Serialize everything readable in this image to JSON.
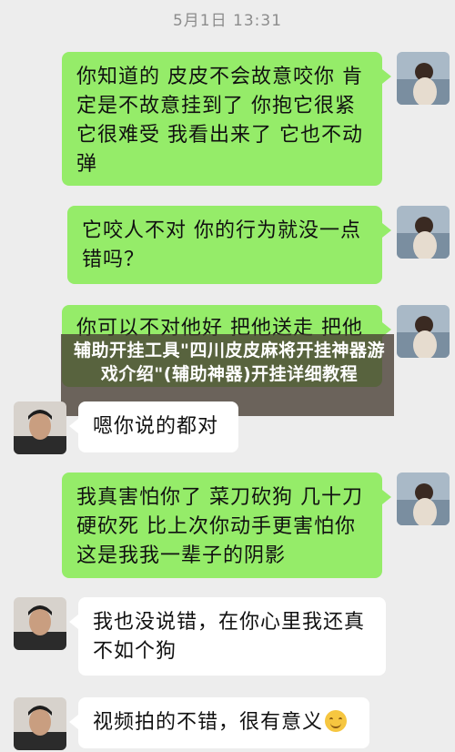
{
  "chat": {
    "timestamp": "5月1日 13:31",
    "messages": [
      {
        "from": "me",
        "text": "你知道的 皮皮不会故意咬你 肯定是不故意挂到了 你抱它很紧 它很难受 我看出来了 它也不动弹"
      },
      {
        "from": "me",
        "text": "它咬人不对 你的行为就没一点错吗？"
      },
      {
        "from": "me",
        "text": "你可以不对他好 把他送走 把他"
      },
      {
        "from": "other",
        "text": "嗯你说的都对"
      },
      {
        "from": "me",
        "text": "我真害怕你了 菜刀砍狗 几十刀硬砍死 比上次你动手更害怕你这是我我一辈子的阴影"
      },
      {
        "from": "other",
        "text": "我也没说错，在你心里我还真不如个狗"
      },
      {
        "from": "other",
        "text": "视频拍的不错，很有意义",
        "emoji": "smiling-face-icon"
      }
    ]
  },
  "overlay": {
    "title": "辅助开挂工具\"四川皮皮麻将开挂神器游戏介绍\"(辅助神器)开挂详细教程"
  },
  "colors": {
    "my_bubble": "#95ec69",
    "their_bubble": "#ffffff",
    "background": "#ededed"
  }
}
